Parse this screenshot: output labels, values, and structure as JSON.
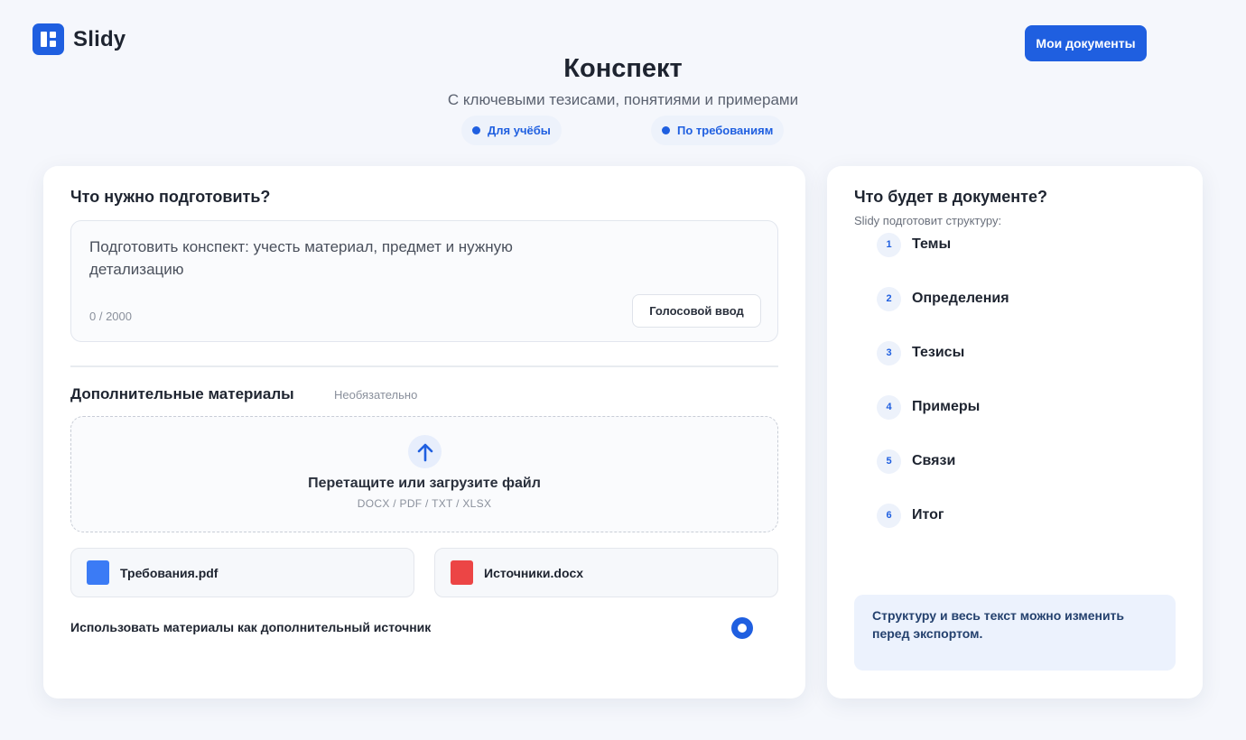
{
  "app": {
    "name": "Slidy",
    "my_docs_label": "Мои документы"
  },
  "hero": {
    "title": "Конспект",
    "subtitle": "С ключевыми тезисами, понятиями и примерами",
    "tags": [
      "Для учёбы",
      "По требованиям"
    ]
  },
  "form": {
    "title": "Что нужно подготовить?",
    "prompt_text": "Подготовить конспект: учесть материал, предмет и нужную детализацию",
    "char_count": "0 / 2000",
    "voice_label": "Голосовой ввод",
    "materials_title": "Дополнительные материалы",
    "optional_label": "Необязательно",
    "dropzone_title": "Перетащите или загрузите файл",
    "dropzone_types": "DOCX / PDF / TXT / XLSX",
    "files": [
      {
        "name": "Требования.pdf",
        "color": "#3b7bf5"
      },
      {
        "name": "Источники.docx",
        "color": "#ec4545"
      }
    ],
    "use_materials_label": "Использовать материалы как дополнительный источник",
    "use_materials_checked": true
  },
  "structure": {
    "title": "Что будет в документе?",
    "subtitle": "Slidy подготовит структуру:",
    "items": [
      {
        "num": "1",
        "label": "Темы"
      },
      {
        "num": "2",
        "label": "Определения"
      },
      {
        "num": "3",
        "label": "Тезисы"
      },
      {
        "num": "4",
        "label": "Примеры"
      },
      {
        "num": "5",
        "label": "Связи"
      },
      {
        "num": "6",
        "label": "Итог"
      }
    ],
    "note": "Структуру и весь текст можно изменить перед экспортом."
  },
  "colors": {
    "accent": "#1f5fe0",
    "background": "#f5f7fc"
  }
}
